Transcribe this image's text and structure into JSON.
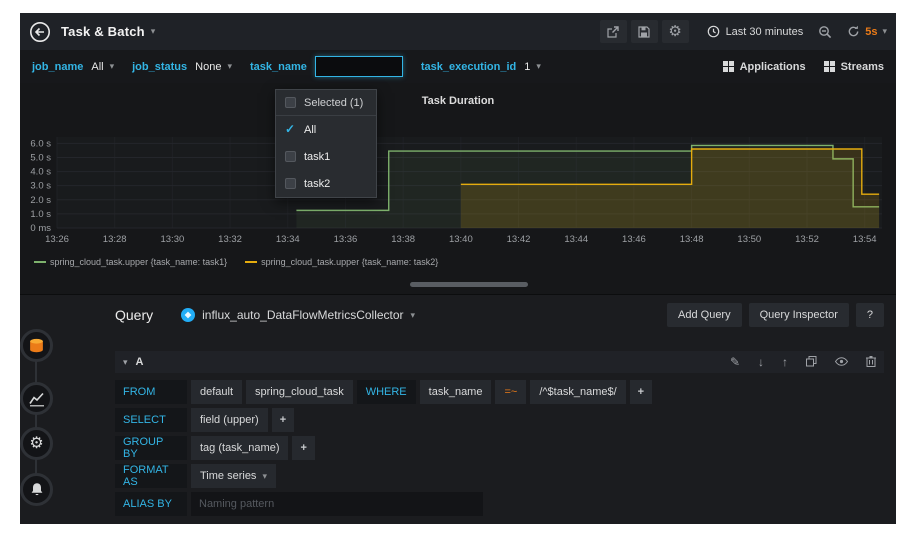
{
  "colors": {
    "accent_blue": "#33b5e5",
    "accent_orange": "#eb7b18",
    "series_green": "#7eb26d",
    "series_yellow": "#e5ac0e"
  },
  "icons": {
    "check": "✓",
    "plus": "+",
    "pencil": "✎",
    "arrow_down": "↓",
    "arrow_up": "↑"
  },
  "navbar": {
    "title": "Task & Batch",
    "time_range": "Last 30 minutes",
    "refresh_interval": "5s"
  },
  "submenu": {
    "variables": [
      {
        "label": "job_name",
        "value": "All"
      },
      {
        "label": "job_status",
        "value": "None"
      },
      {
        "label": "task_name",
        "value": ""
      },
      {
        "label": "task_execution_id",
        "value": "1"
      }
    ],
    "links": [
      {
        "label": "Applications"
      },
      {
        "label": "Streams"
      }
    ]
  },
  "task_name_dropdown": {
    "header": "Selected (1)",
    "options": [
      {
        "label": "All",
        "checked": true
      },
      {
        "label": "task1",
        "checked": false
      },
      {
        "label": "task2",
        "checked": false
      }
    ]
  },
  "chart_data": {
    "type": "line",
    "title": "Task Duration",
    "x_tick_labels": [
      "13:26",
      "13:28",
      "13:30",
      "13:32",
      "13:34",
      "13:36",
      "13:38",
      "13:40",
      "13:42",
      "13:44",
      "13:46",
      "13:48",
      "13:50",
      "13:52",
      "13:54"
    ],
    "x_tick_step_minutes": 2,
    "x_domain_minutes": [
      0,
      28.6
    ],
    "y_domain": [
      0,
      6.45
    ],
    "y_ticks": [
      {
        "label": "6.0 s",
        "value": 6
      },
      {
        "label": "5.0 s",
        "value": 5
      },
      {
        "label": "4.0 s",
        "value": 4
      },
      {
        "label": "3.0 s",
        "value": 3
      },
      {
        "label": "2.0 s",
        "value": 2
      },
      {
        "label": "1.0 s",
        "value": 1
      },
      {
        "label": "0 ms",
        "value": 0
      }
    ],
    "grid": true,
    "legend_position": "bottom",
    "series": [
      {
        "name": "spring_cloud_task.upper {task_name: task1}",
        "color": "#7eb26d",
        "fill_opacity": 0.07,
        "points_min_sec": [
          [
            8.3,
            1.25
          ],
          [
            11.5,
            1.25
          ],
          [
            11.5,
            5.45
          ],
          [
            22,
            5.45
          ],
          [
            22,
            5.85
          ],
          [
            26.9,
            5.85
          ],
          [
            26.9,
            4.9
          ],
          [
            27.6,
            4.9
          ],
          [
            27.6,
            1.5
          ],
          [
            28.5,
            1.5
          ]
        ]
      },
      {
        "name": "spring_cloud_task.upper {task_name: task2}",
        "color": "#e5ac0e",
        "fill_opacity": 0.16,
        "points_min_sec": [
          [
            14,
            3.1
          ],
          [
            22,
            3.1
          ],
          [
            22,
            5.6
          ],
          [
            27.9,
            5.6
          ],
          [
            27.9,
            2.4
          ],
          [
            28.5,
            2.4
          ]
        ]
      }
    ]
  },
  "query_editor": {
    "section_label": "Query",
    "datasource": {
      "name": "influx_auto_DataFlowMetricsCollector"
    },
    "buttons": {
      "add_query": "Add Query",
      "query_inspector": "Query Inspector",
      "help": "?"
    },
    "query": {
      "ref_id": "A",
      "from_label": "FROM",
      "from_policy": "default",
      "from_measurement": "spring_cloud_task",
      "where_keyword": "WHERE",
      "where_field": "task_name",
      "where_operator": "=~",
      "where_value": "/^$task_name$/",
      "select_label": "SELECT",
      "select_value": "field (upper)",
      "group_by_label": "GROUP BY",
      "group_by_value": "tag (task_name)",
      "format_as_label": "FORMAT AS",
      "format_as_value": "Time series",
      "alias_by_label": "ALIAS BY",
      "alias_by_placeholder": "Naming pattern"
    }
  }
}
